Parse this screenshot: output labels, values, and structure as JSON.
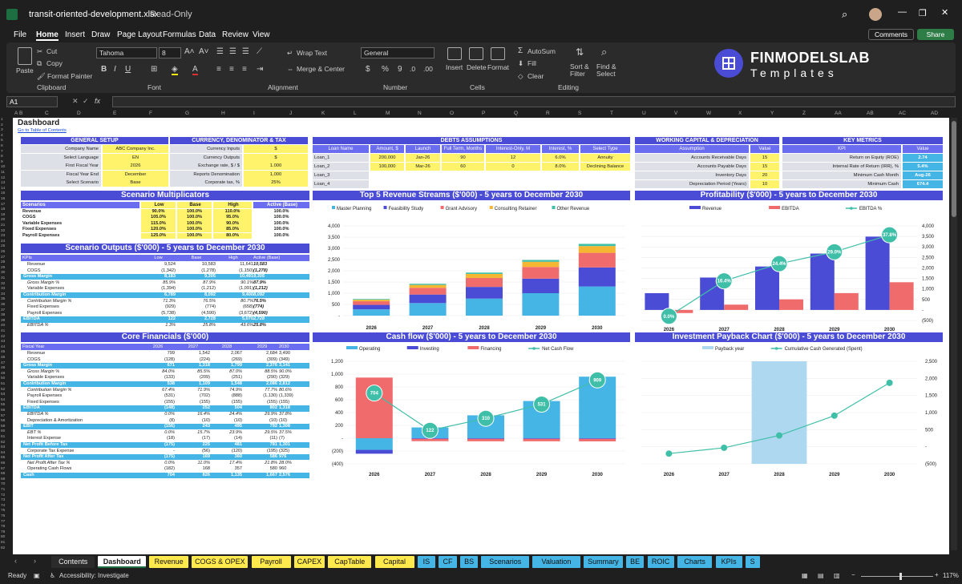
{
  "window": {
    "title": "transit-oriented-development.xlsx",
    "mode": "Read-Only"
  },
  "menu": [
    "File",
    "Home",
    "Insert",
    "Draw",
    "Page Layout",
    "Formulas",
    "Data",
    "Review",
    "View"
  ],
  "actions": {
    "comments": "Comments",
    "share": "Share"
  },
  "ribbon": {
    "paste": "Paste",
    "cut": "Cut",
    "copy": "Copy",
    "format_painter": "Format Painter",
    "clipboard": "Clipboard",
    "font_name": "Tahoma",
    "font_size": "8",
    "font": "Font",
    "wrap": "Wrap Text",
    "merge": "Merge & Center",
    "alignment": "Alignment",
    "number_format": "General",
    "number": "Number",
    "insert": "Insert",
    "delete": "Delete",
    "format": "Format",
    "cells": "Cells",
    "autosum": "AutoSum",
    "fill": "Fill",
    "clear": "Clear",
    "sort": "Sort & Filter",
    "find": "Find & Select",
    "editing": "Editing",
    "logo_main": "FINMODELSLAB",
    "logo_sub": "Templates"
  },
  "cell_ref": "A1",
  "columns": [
    "A",
    "B",
    "C",
    "D",
    "E",
    "F",
    "G",
    "H",
    "I",
    "J",
    "K",
    "L",
    "M",
    "N",
    "O",
    "P",
    "Q",
    "R",
    "S",
    "T",
    "U",
    "V",
    "W",
    "X",
    "Y",
    "Z",
    "AA",
    "AB",
    "AC",
    "AD"
  ],
  "dashboard": {
    "title": "Dashboard",
    "toc": "Go to Table of Contents",
    "general": {
      "title": "GENERAL SETUP",
      "rows": [
        [
          "Company Name",
          "ABC Company Inc."
        ],
        [
          "Select Language",
          "EN"
        ],
        [
          "First Fiscal Year",
          "2026"
        ],
        [
          "Fiscal Year End",
          "December"
        ],
        [
          "Select Scenario",
          "Base"
        ]
      ]
    },
    "currency": {
      "title": "CURRENCY, DENOMINATOR & TAX",
      "rows": [
        [
          "Currency Inputs",
          "$"
        ],
        [
          "Currency Outputs",
          "$"
        ],
        [
          "Exchange rate, $ / $",
          "1.000"
        ],
        [
          "Reports Denomination",
          "1,000"
        ],
        [
          "Corporate tax, %",
          "25%"
        ]
      ]
    },
    "debts": {
      "title": "DEBTS ASSUMPTIONS",
      "headers": [
        "Loan Name",
        "Amount, $",
        "Launch",
        "Full Term, Months",
        "Interest-Only, M",
        "Interest, %",
        "Select Type"
      ],
      "rows": [
        [
          "Loan_1",
          "200,000",
          "Jan-26",
          "90",
          "12",
          "6.0%",
          "Annuity"
        ],
        [
          "Loan_2",
          "100,000",
          "Mar-26",
          "60",
          "0",
          "8.0%",
          "Declining Balance"
        ],
        [
          "Loan_3",
          "",
          "",
          "",
          "",
          "",
          ""
        ],
        [
          "Loan_4",
          "",
          "",
          "",
          "",
          "",
          ""
        ]
      ]
    },
    "wc": {
      "title": "WORKING CAPITAL & DEPRECIATION",
      "headers": [
        "Assumption",
        "Value"
      ],
      "rows": [
        [
          "Accounts Receivable Days",
          "15"
        ],
        [
          "Accounts Payable Days",
          "15"
        ],
        [
          "Inventory Days",
          "20"
        ],
        [
          "Depreciation Period (Years)",
          "10"
        ]
      ]
    },
    "kpi": {
      "title": "KEY METRICS",
      "headers": [
        "KPI",
        "Value"
      ],
      "rows": [
        [
          "Return on Equity (ROE)",
          "2.74"
        ],
        [
          "Internal Rate of Return (IRR), %",
          "5.4%"
        ],
        [
          "Minimum Cash Month",
          "Aug-26"
        ],
        [
          "Minimum Cash",
          "674.4"
        ]
      ]
    },
    "multipliers": {
      "title": "Scenario Multiplicators",
      "headers": [
        "Scenarios",
        "Low",
        "Base",
        "High",
        "Active (Base)"
      ],
      "rows": [
        [
          "Revenue",
          "90.0%",
          "100.0%",
          "110.0%",
          "100.0%"
        ],
        [
          "COGS",
          "105.0%",
          "100.0%",
          "95.0%",
          "100.0%"
        ],
        [
          "Variable Expenses",
          "115.0%",
          "100.0%",
          "90.0%",
          "100.0%"
        ],
        [
          "Fixed Expenses",
          "120.0%",
          "100.0%",
          "85.0%",
          "100.0%"
        ],
        [
          "Payroll Expenses",
          "125.0%",
          "100.0%",
          "80.0%",
          "100.0%"
        ]
      ]
    },
    "outputs": {
      "title": "Scenario Outputs ($'000) - 5 years to December 2030",
      "headers": [
        "KPIs",
        "Low",
        "Base",
        "High",
        "Active (Base)"
      ],
      "rows": [
        [
          "Revenue",
          "9,524",
          "10,583",
          "11,641",
          "10,583",
          ""
        ],
        [
          "COGS",
          "(1,342)",
          "(1,278)",
          "(1,150)",
          "(1,278)",
          ""
        ],
        [
          "Gross Margin",
          "8,183",
          "9,305",
          "10,491",
          "9,305",
          "hl"
        ],
        [
          "Gross Margin %",
          "85.9%",
          "87.9%",
          "90.1%",
          "87.9%",
          "it"
        ],
        [
          "Variable Expenses",
          "(1,394)",
          "(1,212)",
          "(1,091)",
          "(1,212)",
          ""
        ],
        [
          "Contribution Margin",
          "6,789",
          "8,092",
          "9,400",
          "8,092",
          "hl"
        ],
        [
          "Contribution Margin %",
          "71.3%",
          "76.5%",
          "80.7%",
          "76.5%",
          "it"
        ],
        [
          "Fixed Expenses",
          "(929)",
          "(774)",
          "(658)",
          "(774)",
          ""
        ],
        [
          "Payroll Expenses",
          "(5,738)",
          "(4,590)",
          "(3,672)",
          "(4,590)",
          ""
        ],
        [
          "EBITDA",
          "122",
          "2,728",
          "5,070",
          "2,728",
          "hl"
        ],
        [
          "EBITDA %",
          "1.3%",
          "25.8%",
          "43.6%",
          "25.8%",
          "it"
        ]
      ]
    },
    "core": {
      "title": "Core Financials ($'000)",
      "headers": [
        "Fiscal Year",
        "2026",
        "2027",
        "2028",
        "2029",
        "2030"
      ],
      "rows": [
        [
          "Revenue",
          "799",
          "1,542",
          "2,067",
          "2,684",
          "3,490",
          ""
        ],
        [
          "COGS",
          "(128)",
          "(224)",
          "(269)",
          "(309)",
          "(349)",
          ""
        ],
        [
          "Gross Margin",
          "671",
          "1,318",
          "1,799",
          "2,376",
          "3,141",
          "hl"
        ],
        [
          "Gross Margin %",
          "84.0%",
          "85.5%",
          "87.0%",
          "88.5%",
          "90.0%",
          "it"
        ],
        [
          "Variable Expenses",
          "(133)",
          "(209)",
          "(251)",
          "(290)",
          "(329)",
          ""
        ],
        [
          "Contribution Margin",
          "538",
          "1,109",
          "1,548",
          "2,086",
          "2,812",
          "hl"
        ],
        [
          "Contribution Margin %",
          "67.4%",
          "71.9%",
          "74.9%",
          "77.7%",
          "80.6%",
          "it"
        ],
        [
          "Payroll Expenses",
          "(531)",
          "(702)",
          "(888)",
          "(1,130)",
          "(1,339)",
          ""
        ],
        [
          "Fixed Expenses",
          "(155)",
          "(155)",
          "(155)",
          "(155)",
          "(155)",
          ""
        ],
        [
          "EBITDA",
          "(148)",
          "252",
          "504",
          "802",
          "1,318",
          "hl"
        ],
        [
          "EBITDA %",
          "0.0%",
          "16.4%",
          "24.4%",
          "29.9%",
          "37.8%",
          "it"
        ],
        [
          "Depreciation & Amortization",
          "(8)",
          "(10)",
          "(10)",
          "(10)",
          "(10)",
          ""
        ],
        [
          "EBIT",
          "(156)",
          "243",
          "495",
          "792",
          "1,308",
          "hl"
        ],
        [
          "EBT %",
          "0.0%",
          "15.7%",
          "23.9%",
          "29.5%",
          "37.5%",
          "it"
        ],
        [
          "Interest Expense",
          "(18)",
          "(17)",
          "(14)",
          "(11)",
          "(7)",
          ""
        ],
        [
          "Net Profit Before Tax",
          "(175)",
          "225",
          "481",
          "781",
          "1,301",
          "hl"
        ],
        [
          "Corporate Tax Expense",
          "-",
          "(56)",
          "(120)",
          "(195)",
          "(325)",
          ""
        ],
        [
          "Net Profit After Tax",
          "(175)",
          "169",
          "360",
          "586",
          "976",
          "hl"
        ],
        [
          "Net Profit After Tax %",
          "0.0%",
          "11.0%",
          "17.4%",
          "21.8%",
          "28.0%",
          "it"
        ],
        [
          "Operating Cash Flows",
          "(182)",
          "168",
          "357",
          "580",
          "960",
          ""
        ],
        [
          "Cash",
          "704",
          "826",
          "1,135",
          "1,667",
          "2,576",
          "hl"
        ]
      ]
    }
  },
  "chart_data": [
    {
      "type": "bar",
      "stacked": true,
      "title": "Top 5 Revenue Streams ($'000) - 5 years to December 2030",
      "categories": [
        "2026",
        "2027",
        "2028",
        "2029",
        "2030"
      ],
      "ylim": [
        0,
        4000
      ],
      "series": [
        {
          "name": "Master Planning",
          "color": "#45b5e6",
          "values": [
            280,
            560,
            760,
            1000,
            1300
          ]
        },
        {
          "name": "Feasibility Study",
          "color": "#4a4cd6",
          "values": [
            200,
            380,
            520,
            650,
            850
          ]
        },
        {
          "name": "Grant Advisory",
          "color": "#f06b6b",
          "values": [
            160,
            300,
            400,
            520,
            650
          ]
        },
        {
          "name": "Consulting Retainer",
          "color": "#f5b731",
          "values": [
            70,
            130,
            180,
            230,
            300
          ]
        },
        {
          "name": "Other Revenue",
          "color": "#3fbfa8",
          "values": [
            30,
            50,
            60,
            80,
            100
          ]
        }
      ]
    },
    {
      "type": "bar+line",
      "title": "Profitability ($'000) - 5 years to December 2030",
      "categories": [
        "2026",
        "2027",
        "2028",
        "2029",
        "2030"
      ],
      "ylim": [
        -500,
        4000
      ],
      "series": [
        {
          "name": "Revenue",
          "color": "#4a4cd6",
          "values": [
            799,
            1542,
            2067,
            2684,
            3490
          ]
        },
        {
          "name": "EBITDA",
          "color": "#f06b6b",
          "values": [
            -148,
            252,
            504,
            802,
            1318
          ]
        },
        {
          "name": "EBITDA %",
          "color": "#3fbfa8",
          "values": [
            0.0,
            16.4,
            24.4,
            29.9,
            37.8
          ],
          "labels": [
            "0.0%",
            "16.4%",
            "24.4%",
            "29.0%",
            "37.8%"
          ]
        }
      ]
    },
    {
      "type": "bar+line",
      "title": "Cash flow ($'000) - 5 years to December 2030",
      "categories": [
        "2026",
        "2027",
        "2028",
        "2029",
        "2030"
      ],
      "ylim": [
        -400,
        1200
      ],
      "series": [
        {
          "name": "Operating",
          "color": "#45b5e6",
          "values": [
            -182,
            168,
            357,
            580,
            960
          ]
        },
        {
          "name": "Investing",
          "color": "#4a4cd6",
          "values": [
            -60,
            -10,
            -10,
            -10,
            -10
          ]
        },
        {
          "name": "Financing",
          "color": "#f06b6b",
          "values": [
            946,
            -36,
            -38,
            -38,
            -39
          ]
        },
        {
          "name": "Net Cash Flow",
          "color": "#3fbfa8",
          "values": [
            704,
            122,
            310,
            531,
            909
          ],
          "labels": [
            "704",
            "122",
            "310",
            "531",
            "909"
          ]
        }
      ]
    },
    {
      "type": "bar+line",
      "title": "Investment Payback Chart ($'000) - 5 years to December 2030",
      "categories": [
        "2026",
        "2027",
        "2028",
        "2029",
        "2030"
      ],
      "ylim": [
        -500,
        2500
      ],
      "series": [
        {
          "name": "Payback year",
          "color": "#aed8f0",
          "values": [
            0,
            0,
            1,
            0,
            0
          ]
        },
        {
          "name": "Cumulative Cash Generated (Spent)",
          "color": "#3fbfa8",
          "values": [
            -200,
            -30,
            330,
            910,
            1870
          ]
        }
      ]
    }
  ],
  "tabs": [
    "Contents",
    "Dashboard",
    "Revenue",
    "COGS & OPEX",
    "Payroll",
    "CAPEX",
    "CapTable",
    "Capital",
    "IS",
    "CF",
    "BS",
    "Scenarios",
    "Valuation",
    "Summary",
    "BE",
    "ROIC",
    "Charts",
    "KPIs",
    "S"
  ],
  "status": {
    "ready": "Ready",
    "accessibility": "Accessibility: Investigate",
    "zoom": "117%"
  }
}
